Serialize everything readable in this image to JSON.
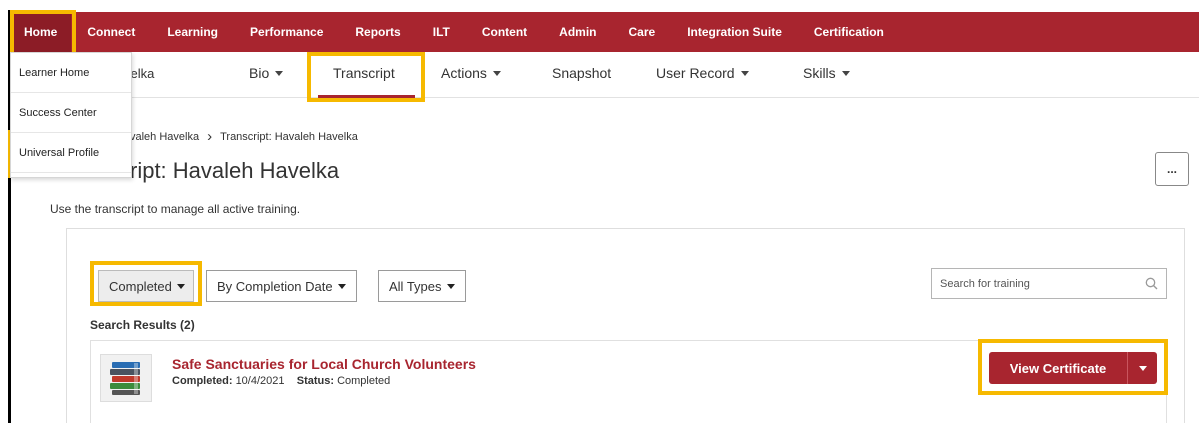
{
  "topnav": {
    "items": [
      "Home",
      "Connect",
      "Learning",
      "Performance",
      "Reports",
      "ILT",
      "Content",
      "Admin",
      "Care",
      "Integration Suite",
      "Certification"
    ]
  },
  "home_menu": {
    "items": [
      "Learner Home",
      "Success Center",
      "Universal Profile"
    ]
  },
  "profile": {
    "user_name_partial": "velka",
    "tabs": [
      "Bio",
      "Transcript",
      "Actions",
      "Snapshot",
      "User Record",
      "Skills"
    ],
    "active_tab": "Transcript"
  },
  "breadcrumb": {
    "parent": "valeh Havelka",
    "separator": "›",
    "current": "Transcript: Havaleh Havelka"
  },
  "page": {
    "title": "ript: Havaleh Havelka",
    "more_label": "...",
    "subtitle": "Use the transcript to manage all active training."
  },
  "filters": {
    "status": "Completed",
    "sort": "By Completion Date",
    "type": "All Types"
  },
  "search": {
    "placeholder": "Search for training"
  },
  "results": {
    "label": "Search Results (2)",
    "items": [
      {
        "title": "Safe Sanctuaries for Local Church Volunteers",
        "completed_label": "Completed:",
        "completed_date": "10/4/2021",
        "status_label": "Status:",
        "status": "Completed",
        "action": "View Certificate"
      }
    ]
  },
  "colors": {
    "brand": "#a8252f",
    "highlight": "#f6b900"
  },
  "icons": {
    "course": "book-stack-icon",
    "search": "search-icon",
    "more": "ellipsis-icon"
  }
}
